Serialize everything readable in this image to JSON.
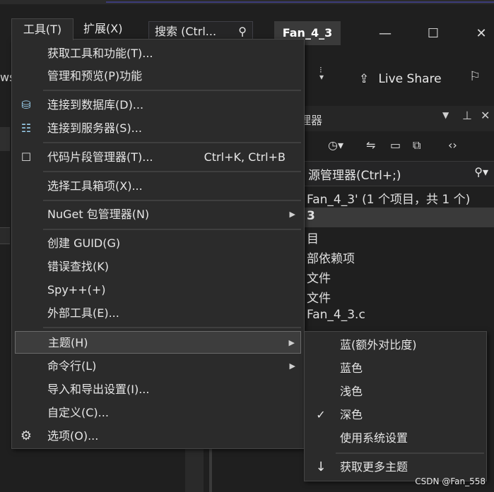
{
  "menubar": {
    "tools": "工具(T)",
    "extensions": "扩展(X)",
    "search_text": "搜索 (Ctrl..."
  },
  "document_tab": "Fan_4_3",
  "window_buttons": {
    "minimize": "—",
    "maximize": "☐",
    "close": "✕"
  },
  "vs_cut": "ws",
  "live_share": "Live Share",
  "solution_explorer": {
    "title": "理器",
    "search": "源管理器(Ctrl+;)",
    "tree": [
      "Fan_4_3' (1 个项目，共 1 个)",
      "3",
      "目",
      "部依赖项",
      "文件",
      "文件",
      "Fan_4_3.c"
    ]
  },
  "tools_menu": {
    "get_tools": "获取工具和功能(T)...",
    "manage_preview": "管理和预览(P)功能",
    "connect_db": "连接到数据库(D)...",
    "connect_server": "连接到服务器(S)...",
    "snippets": "代码片段管理器(T)...",
    "snippets_shortcut": "Ctrl+K, Ctrl+B",
    "toolbox": "选择工具箱项(X)...",
    "nuget": "NuGet 包管理器(N)",
    "guid": "创建 GUID(G)",
    "error_lookup": "错误查找(K)",
    "spy": "Spy++(+)",
    "external": "外部工具(E)...",
    "theme": "主题(H)",
    "cmdline": "命令行(L)",
    "import_export": "导入和导出设置(I)...",
    "customize": "自定义(C)...",
    "options": "选项(O)..."
  },
  "theme_submenu": {
    "blue_contrast": "蓝(额外对比度)",
    "blue": "蓝色",
    "light": "浅色",
    "dark": "深色",
    "system": "使用系统设置",
    "more": "获取更多主题",
    "checked": "✓"
  },
  "watermark": "CSDN @Fan_558",
  "colors": {
    "menu_bg": "#2b2b2b",
    "highlight": "#3d3d3d",
    "text": "#e6e6e6",
    "bg": "#1f1f1f"
  }
}
